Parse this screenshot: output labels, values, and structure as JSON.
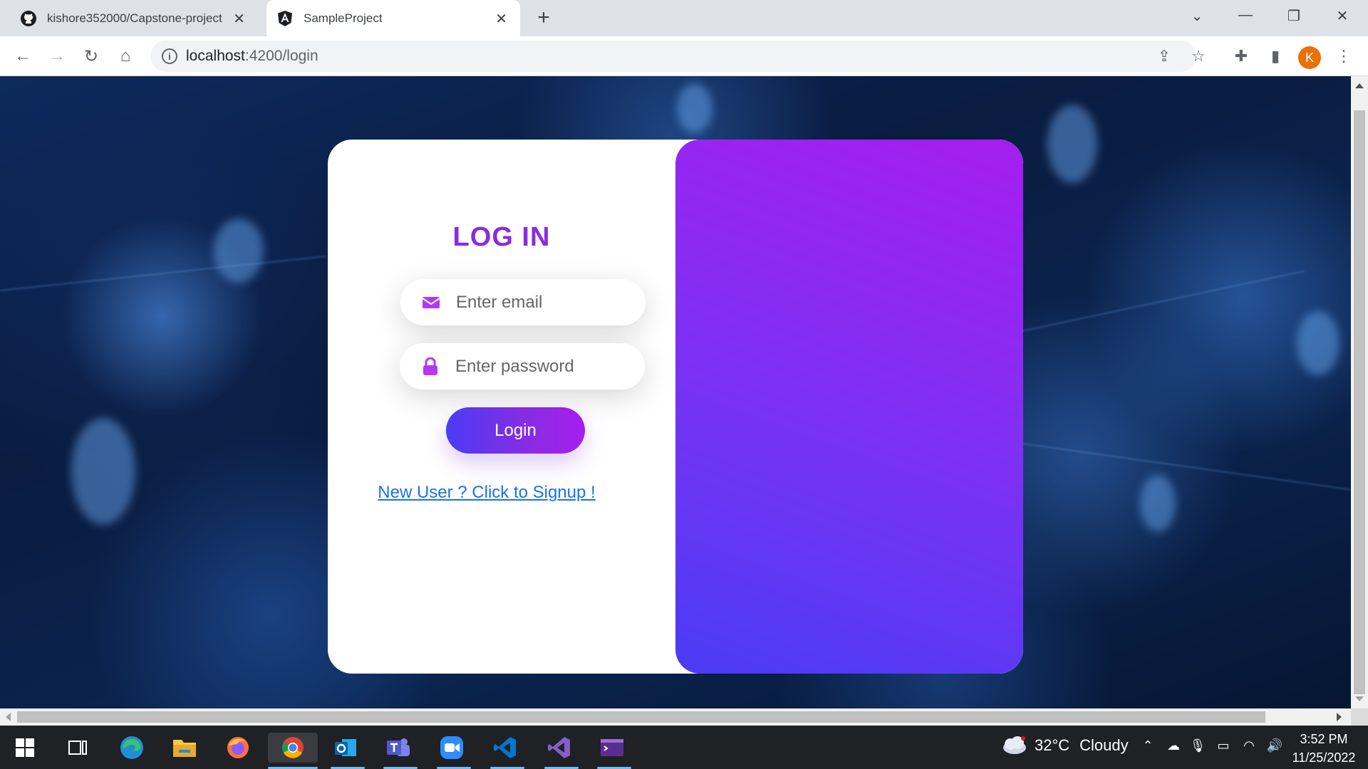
{
  "browser": {
    "tabs": [
      {
        "title": "kishore352000/Capstone-project",
        "icon": "github-icon",
        "active": false
      },
      {
        "title": "SampleProject",
        "icon": "angular-icon",
        "active": true
      }
    ],
    "url_host": "localhost",
    "url_path": ":4200/login",
    "profile_initial": "K",
    "colors": {
      "tabstrip": "#dee1e6",
      "avatar": "#e8710a"
    }
  },
  "login": {
    "title": "LOG IN",
    "email_placeholder": "Enter email",
    "password_placeholder": "Enter password",
    "button_label": "Login",
    "signup_link": "New User ? Click to Signup !",
    "colors": {
      "title": "#8a2be2",
      "panel_top": "#a61ef0",
      "panel_bottom": "#4a3cf5",
      "link": "#1a73e8"
    }
  },
  "taskbar": {
    "apps": [
      "start-icon",
      "task-view-icon",
      "edge-icon",
      "file-explorer-icon",
      "firefox-icon",
      "chrome-icon",
      "outlook-icon",
      "teams-icon",
      "zoom-icon",
      "vscode-icon",
      "visual-studio-icon",
      "terminal-icon"
    ],
    "weather_temp": "32°C",
    "weather_desc": "Cloudy",
    "time": "3:52 PM",
    "date": "11/25/2022"
  }
}
